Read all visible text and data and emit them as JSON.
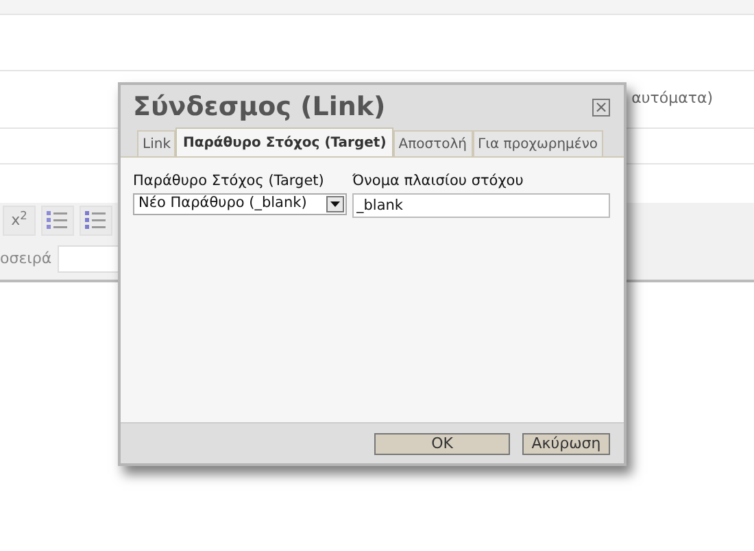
{
  "background": {
    "auto_note": "αυτόματα)",
    "toolbar": [
      {
        "kind": "text",
        "label": "x$^{2}$"
      },
      {
        "kind": "ordered-list"
      },
      {
        "kind": "bullet-list"
      }
    ],
    "order_label": "οσειρά"
  },
  "dialog": {
    "title": "Σύνδεσμος (Link)",
    "close": "×",
    "tabs": [
      {
        "label": "Link",
        "selected": false
      },
      {
        "label": "Παράθυρο Στόχος (Target)",
        "selected": true
      },
      {
        "label": "Αποστολή",
        "selected": false
      },
      {
        "label": "Για προχωρημένο",
        "selected": false
      }
    ],
    "target_label": "Παράθυρο Στόχος (Target)",
    "target_value": "Νέο Παράθυρο (_blank)",
    "frame_label": "Όνομα πλαισίου στόχου",
    "frame_value": "_blank",
    "buttons": [
      {
        "kind": "ok",
        "label": "OK"
      },
      {
        "kind": "cancel",
        "label": "Ακύρωση"
      }
    ]
  }
}
